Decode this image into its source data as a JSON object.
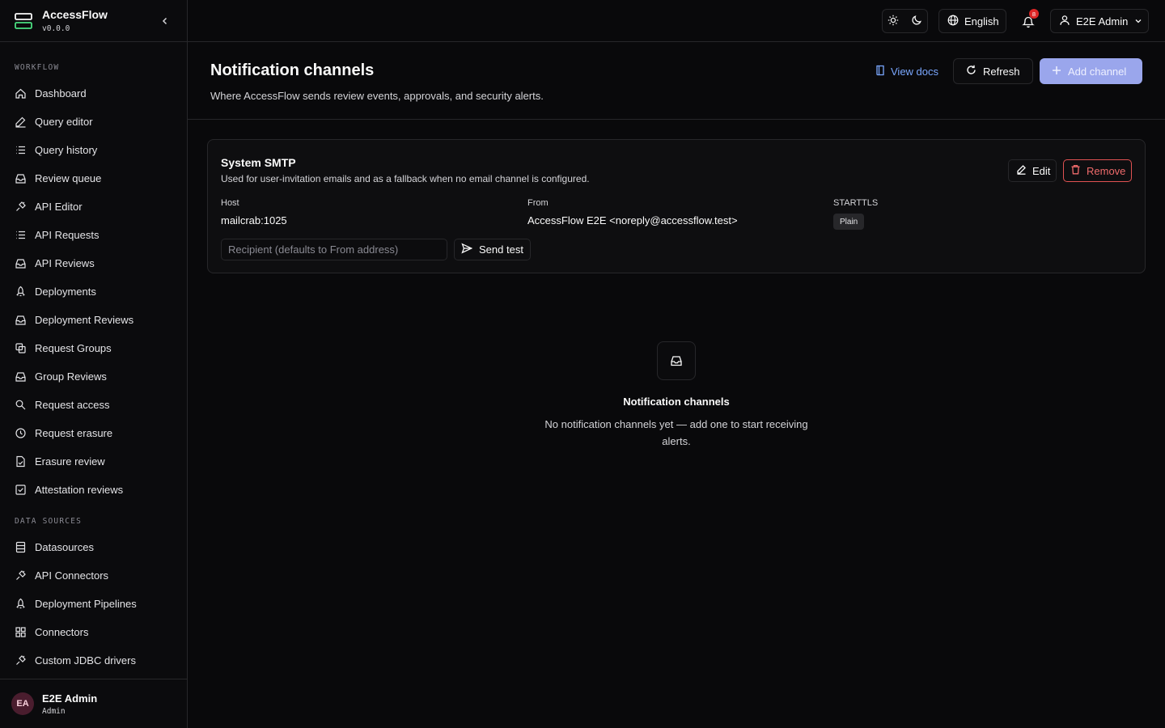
{
  "app": {
    "name": "AccessFlow",
    "version": "v0.0.0"
  },
  "sidebar": {
    "sections": [
      {
        "label": "WORKFLOW",
        "items": [
          {
            "label": "Dashboard",
            "icon": "home-icon"
          },
          {
            "label": "Query editor",
            "icon": "pencil-icon"
          },
          {
            "label": "Query history",
            "icon": "list-icon"
          },
          {
            "label": "Review queue",
            "icon": "inbox-icon"
          },
          {
            "label": "API Editor",
            "icon": "plug-icon"
          },
          {
            "label": "API Requests",
            "icon": "list-icon"
          },
          {
            "label": "API Reviews",
            "icon": "inbox-icon"
          },
          {
            "label": "Deployments",
            "icon": "rocket-icon"
          },
          {
            "label": "Deployment Reviews",
            "icon": "inbox-icon"
          },
          {
            "label": "Request Groups",
            "icon": "copy-icon"
          },
          {
            "label": "Group Reviews",
            "icon": "inbox-icon"
          },
          {
            "label": "Request access",
            "icon": "key-icon"
          },
          {
            "label": "Request erasure",
            "icon": "history-icon"
          },
          {
            "label": "Erasure review",
            "icon": "file-check-icon"
          },
          {
            "label": "Attestation reviews",
            "icon": "checkbox-icon"
          }
        ]
      },
      {
        "label": "DATA SOURCES",
        "items": [
          {
            "label": "Datasources",
            "icon": "database-icon"
          },
          {
            "label": "API Connectors",
            "icon": "plug-icon"
          },
          {
            "label": "Deployment Pipelines",
            "icon": "rocket-icon"
          },
          {
            "label": "Connectors",
            "icon": "grid-icon"
          },
          {
            "label": "Custom JDBC drivers",
            "icon": "plug-icon"
          }
        ]
      }
    ],
    "user": {
      "initials": "EA",
      "name": "E2E Admin",
      "role": "Admin"
    }
  },
  "topbar": {
    "language": "English",
    "notification_count": "8",
    "user": "E2E Admin"
  },
  "page": {
    "title": "Notification channels",
    "subtitle": "Where AccessFlow sends review events, approvals, and security alerts.",
    "view_docs": "View docs",
    "refresh": "Refresh",
    "add_channel": "Add channel"
  },
  "smtp": {
    "title": "System SMTP",
    "description": "Used for user-invitation emails and as a fallback when no email channel is configured.",
    "edit": "Edit",
    "remove": "Remove",
    "host_label": "Host",
    "host": "mailcrab:1025",
    "from_label": "From",
    "from": "AccessFlow E2E <noreply@accessflow.test>",
    "starttls_label": "STARTTLS",
    "starttls": "Plain",
    "recipient_placeholder": "Recipient (defaults to From address)",
    "send_test": "Send test"
  },
  "empty": {
    "title": "Notification channels",
    "description": "No notification channels yet — add one to start receiving alerts."
  },
  "colors": {
    "background": "#09090b",
    "border": "#27272a",
    "accent": "#9aa6ec",
    "link": "#7aa7ff",
    "danger": "#ef6b6b",
    "badge": "#dc2626"
  }
}
